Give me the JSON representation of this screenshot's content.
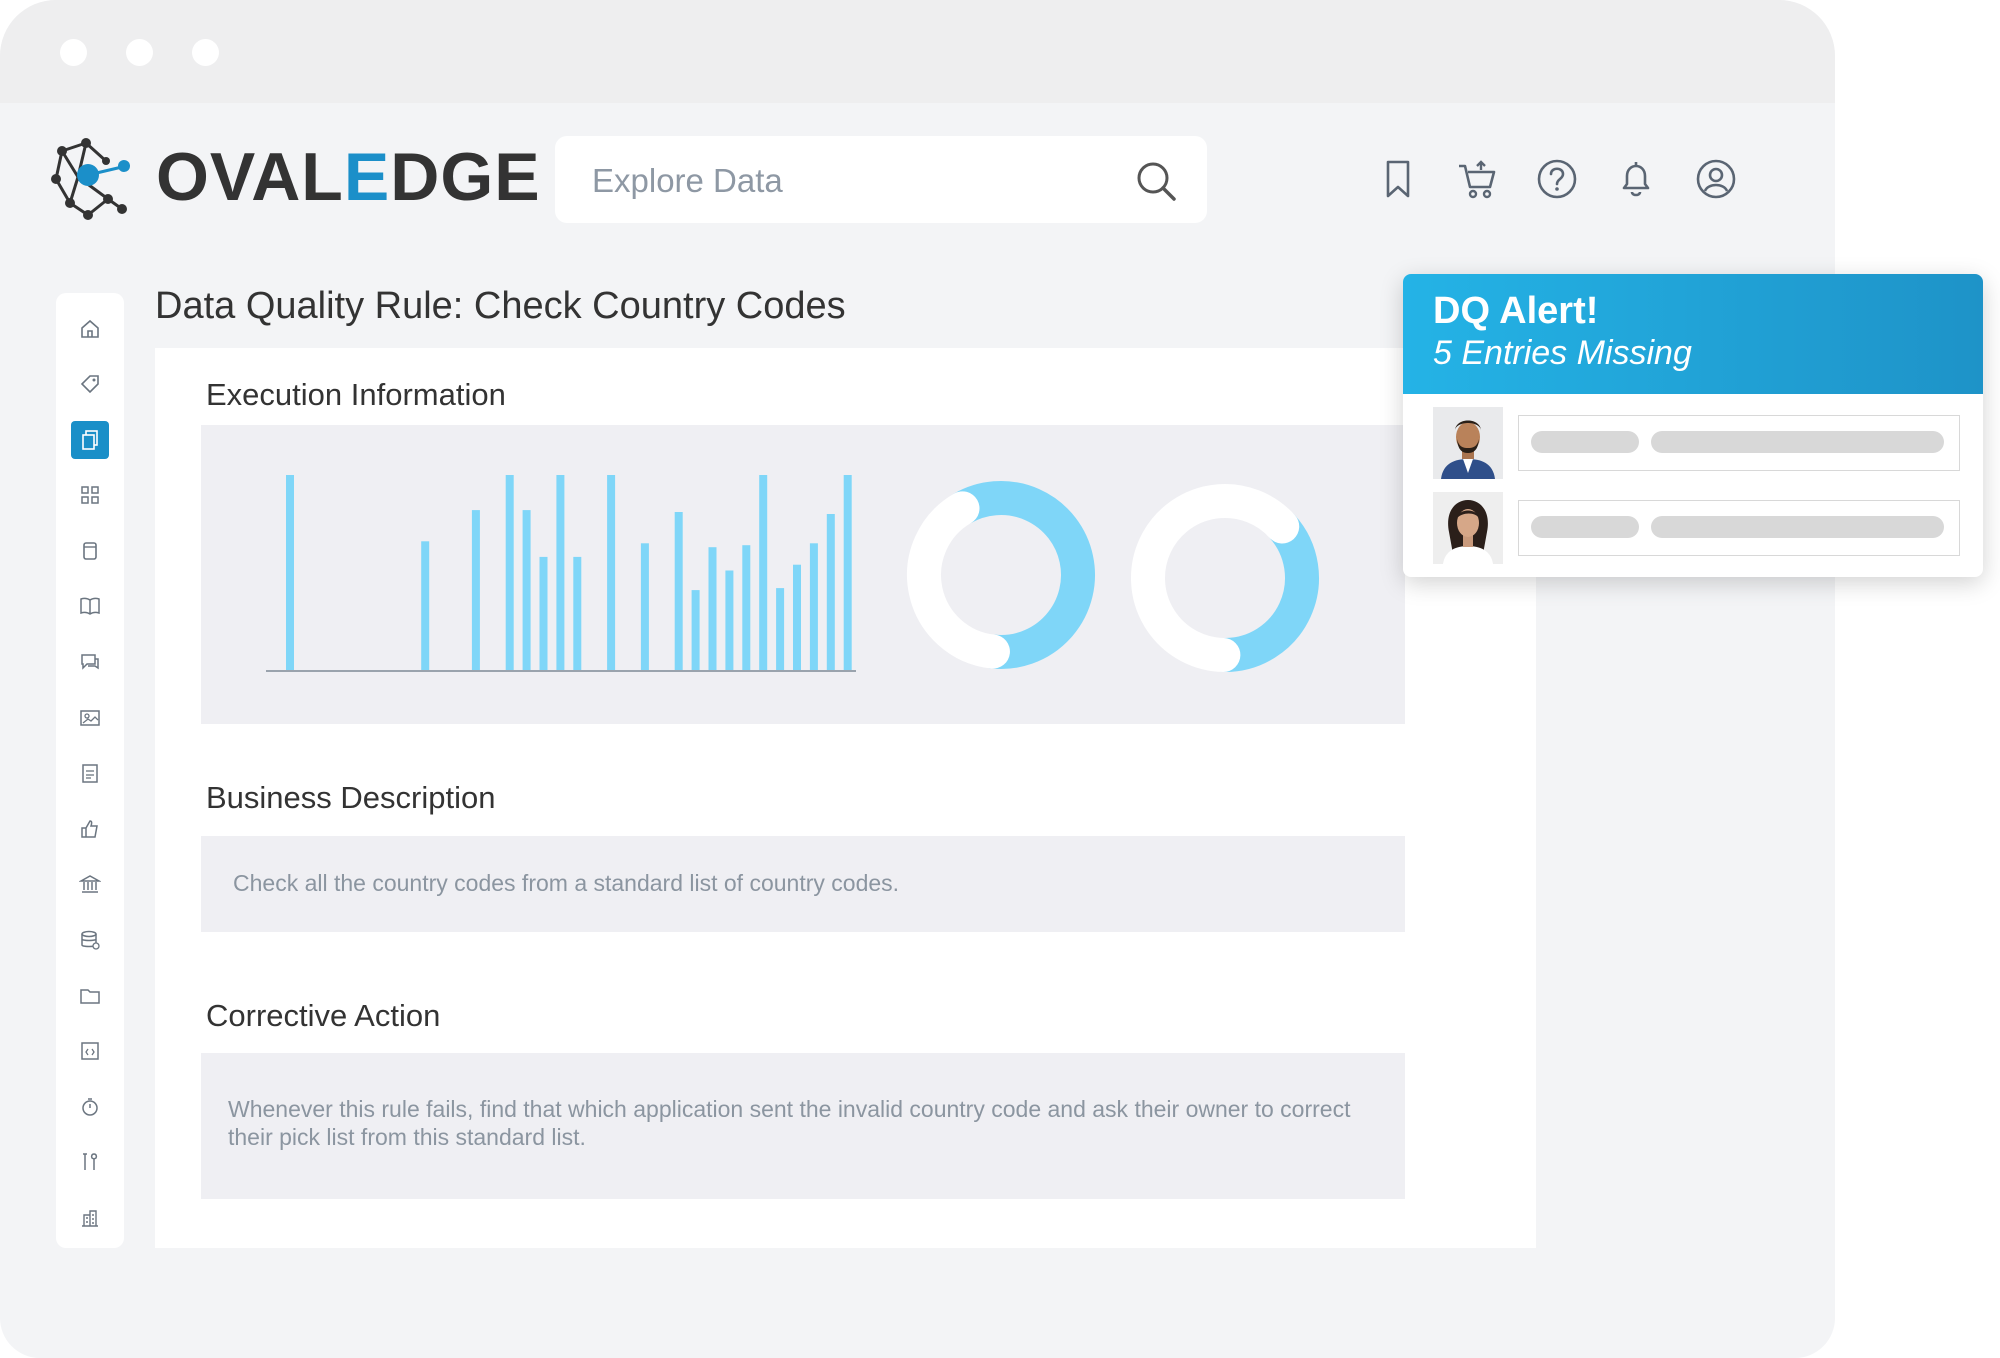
{
  "app": {
    "brand_prefix": "OVAL",
    "brand_highlight": "E",
    "brand_suffix": "DGE"
  },
  "search": {
    "placeholder": "Explore Data"
  },
  "header_icons": [
    "bookmark-icon",
    "cart-icon",
    "help-icon",
    "bell-icon",
    "user-icon"
  ],
  "sidebar": {
    "items": [
      {
        "icon": "home-icon",
        "active": false
      },
      {
        "icon": "tag-icon",
        "active": false
      },
      {
        "icon": "documents-icon",
        "active": true
      },
      {
        "icon": "grid-icon",
        "active": false
      },
      {
        "icon": "file-icon",
        "active": false
      },
      {
        "icon": "book-icon",
        "active": false
      },
      {
        "icon": "chat-icon",
        "active": false
      },
      {
        "icon": "image-icon",
        "active": false
      },
      {
        "icon": "checklist-icon",
        "active": false
      },
      {
        "icon": "thumb-icon",
        "active": false
      },
      {
        "icon": "bank-icon",
        "active": false
      },
      {
        "icon": "database-icon",
        "active": false
      },
      {
        "icon": "folder-icon",
        "active": false
      },
      {
        "icon": "code-icon",
        "active": false
      },
      {
        "icon": "timer-icon",
        "active": false
      },
      {
        "icon": "tools-icon",
        "active": false
      },
      {
        "icon": "building-icon",
        "active": false
      }
    ]
  },
  "page": {
    "title": "Data Quality Rule: Check Country Codes"
  },
  "sections": {
    "execution_title": "Execution Information",
    "business_title": "Business Description",
    "business_text": "Check all the country codes from a standard list of country codes.",
    "corrective_title": "Corrective Action",
    "corrective_text": "Whenever this rule fails, find that which application sent the invalid country code and ask their owner to correct their pick list from this standard list."
  },
  "chart_data": [
    {
      "type": "bar",
      "values": [
        100,
        0,
        0,
        0,
        0,
        0,
        0,
        0,
        66,
        0,
        0,
        82,
        0,
        100,
        82,
        58,
        100,
        58,
        0,
        100,
        0,
        65,
        0,
        81,
        41,
        63,
        51,
        64,
        100,
        42,
        54,
        65,
        80,
        100
      ],
      "ylim": [
        0,
        100
      ],
      "colors": {
        "bar": "#7fd6f8",
        "axis": "#9aa3ad"
      }
    },
    {
      "type": "pie",
      "values": [
        60,
        40
      ],
      "colors": [
        "#7fd6f8",
        "#ffffff"
      ]
    },
    {
      "type": "pie",
      "values": [
        37,
        63
      ],
      "colors": [
        "#7fd6f8",
        "#ffffff"
      ]
    }
  ],
  "alert": {
    "title": "DQ Alert!",
    "subtitle": "5 Entries Missing",
    "entries": [
      {
        "avatar": "man-avatar"
      },
      {
        "avatar": "woman-avatar"
      }
    ]
  },
  "colors": {
    "accent": "#1a8fc8",
    "alert_gradient_start": "#24b3e6",
    "alert_gradient_end": "#1e93c8"
  }
}
